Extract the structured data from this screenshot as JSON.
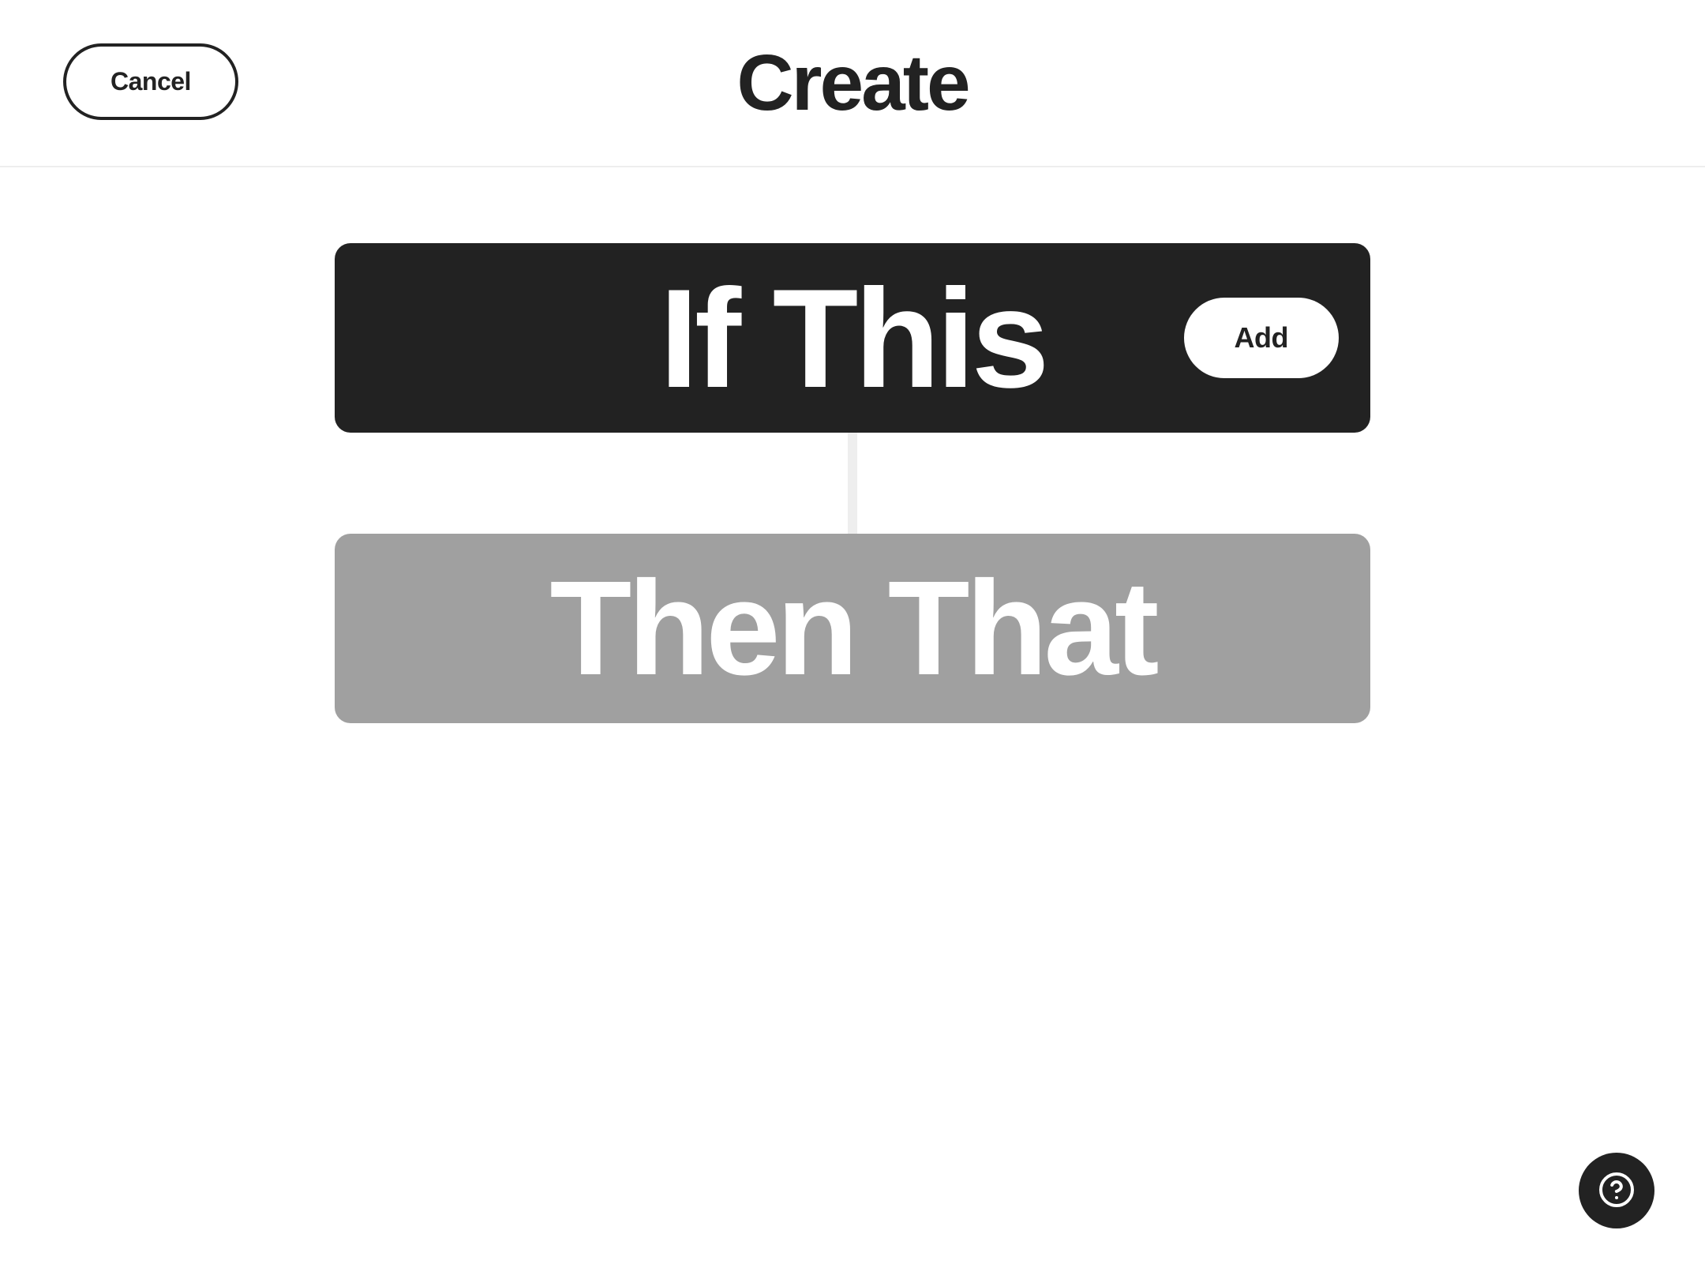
{
  "header": {
    "cancel_label": "Cancel",
    "title": "Create"
  },
  "builder": {
    "trigger": {
      "label": "If This",
      "add_label": "Add"
    },
    "action": {
      "label": "Then That"
    }
  },
  "help": {
    "icon_name": "help"
  },
  "colors": {
    "dark": "#222222",
    "disabled": "#a0a0a0",
    "divider": "#eeeeee"
  }
}
